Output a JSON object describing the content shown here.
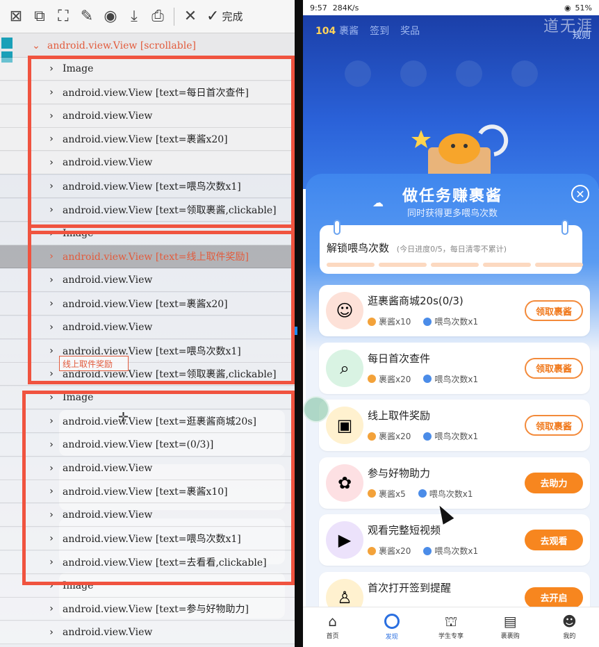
{
  "toolbar": {
    "icons": [
      "select-icon",
      "copy-icon",
      "crop-icon",
      "pin-icon",
      "record-icon",
      "download-icon",
      "bookmark-icon",
      "close-icon"
    ],
    "done_label": "完成"
  },
  "tree": {
    "header": "android.view.View [scrollable]",
    "rows": [
      "Image",
      "android.view.View [text=每日首次查件]",
      "android.view.View",
      "android.view.View [text=裹酱x20]",
      "android.view.View",
      "android.view.View [text=喂鸟次数x1]",
      "android.view.View [text=领取裹酱,clickable]",
      "Image",
      "android.view.View [text=线上取件奖励]",
      "android.view.View",
      "android.view.View [text=裹酱x20]",
      "android.view.View",
      "android.view.View [text=喂鸟次数x1]",
      "android.view.View [text=领取裹酱,clickable]",
      "Image",
      "android.view.View [text=逛裹酱商城20s]",
      "android.view.View [text=(0/3)]",
      "android.view.View",
      "android.view.View [text=裹酱x10]",
      "android.view.View",
      "android.view.View [text=喂鸟次数x1]",
      "android.view.View [text=去看看,clickable]",
      "Image",
      "android.view.View [text=参与好物助力]",
      "android.view.View"
    ],
    "overlay_label": "线上取件奖励"
  },
  "phone": {
    "status": {
      "time": "9:57",
      "speed": "284K/s",
      "battery": "51%"
    },
    "hero": {
      "coins_count": "104",
      "coins_label": "裹酱",
      "sign": "签到",
      "prize": "奖品",
      "rule": "规则",
      "watermark": "道无涯"
    },
    "card": {
      "title": "做任务赚裹酱",
      "subtitle": "同时获得更多喂鸟次数",
      "progress_title": "解锁喂鸟次数",
      "progress_note": "(今日进度0/5，每日清零不累计)",
      "progress_done": 0,
      "progress_total": 5
    },
    "tasks": [
      {
        "name": "逛裹酱商城20s(0/3)",
        "reward1": "裹酱x10",
        "reward2": "喂鸟次数x1",
        "button": "领取裹酱",
        "style": "outline",
        "icon_color": "#fde1d8",
        "icon": "☺"
      },
      {
        "name": "每日首次查件",
        "reward1": "裹酱x20",
        "reward2": "喂鸟次数x1",
        "button": "领取裹酱",
        "style": "outline",
        "icon_color": "#d9f3e3",
        "icon": "⌕"
      },
      {
        "name": "线上取件奖励",
        "reward1": "裹酱x20",
        "reward2": "喂鸟次数x1",
        "button": "领取裹酱",
        "style": "outline",
        "icon_color": "#fff1cf",
        "icon": "▣"
      },
      {
        "name": "参与好物助力",
        "reward1": "裹酱x5",
        "reward2": "喂鸟次数x1",
        "button": "去助力",
        "style": "solid",
        "icon_color": "#fde0e3",
        "icon": "✿"
      },
      {
        "name": "观看完整短视频",
        "reward1": "裹酱x20",
        "reward2": "喂鸟次数x1",
        "button": "去观看",
        "style": "solid",
        "icon_color": "#ece2fb",
        "icon": "▶"
      },
      {
        "name": "首次打开签到提醒",
        "reward1": "",
        "reward2": "",
        "button": "去开启",
        "style": "solid",
        "icon_color": "#fff1cf",
        "icon": "♙"
      }
    ],
    "tabs": [
      {
        "label": "首页",
        "icon": "home-icon",
        "glyph": "⌂"
      },
      {
        "label": "发现",
        "icon": "discover-icon",
        "glyph": "",
        "active": true
      },
      {
        "label": "学生专享",
        "icon": "graduation-cap-icon",
        "glyph": "⛫"
      },
      {
        "label": "裹裹购",
        "icon": "shopping-box-icon",
        "glyph": "▤"
      },
      {
        "label": "我的",
        "icon": "profile-icon",
        "glyph": "☻"
      }
    ]
  }
}
